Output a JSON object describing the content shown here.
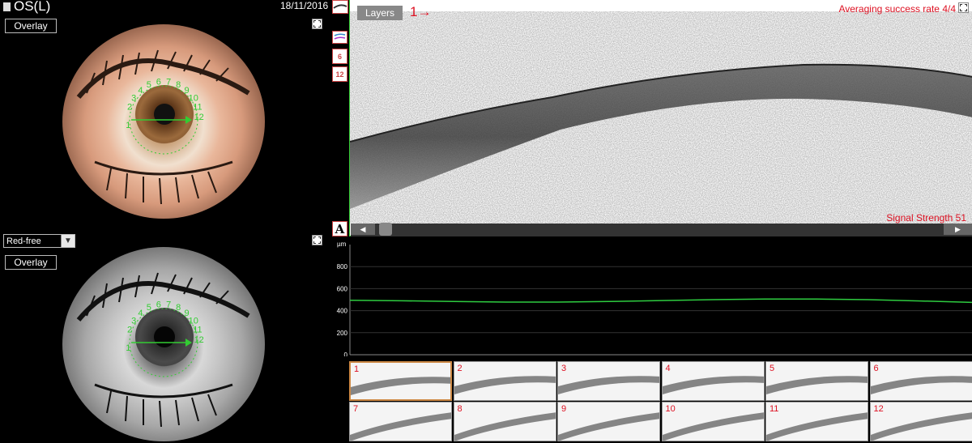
{
  "header": {
    "eye": "OS(L)",
    "date": "18/11/2016"
  },
  "left_panel": {
    "top_overlay_label": "Overlay",
    "filter_select_value": "Red-free",
    "bottom_overlay_label": "Overlay",
    "scan_overlay_numbers": [
      "1",
      "2",
      "3",
      "4",
      "5",
      "6",
      "7",
      "8",
      "9",
      "10",
      "11",
      "12"
    ]
  },
  "tools": {
    "tool_6_label": "6",
    "tool_12_label": "12",
    "a_label": "A"
  },
  "oct": {
    "layers_button": "Layers",
    "scan_indicator": "1→",
    "averaging": "Averaging success rate 4/4",
    "signal": "Signal Strength 51"
  },
  "chart_data": {
    "type": "line",
    "ylabel": "µm",
    "ylim": [
      0,
      1000
    ],
    "yticks": [
      0,
      200,
      400,
      600,
      800
    ],
    "series": [
      {
        "values": [
          495,
          490,
          484,
          478,
          478,
          483,
          492,
          500,
          505,
          505,
          500,
          488,
          475
        ]
      }
    ],
    "color": "#2ecc40"
  },
  "thumbnails": {
    "labels": [
      "1",
      "2",
      "3",
      "4",
      "5",
      "6",
      "7",
      "8",
      "9",
      "10",
      "11",
      "12"
    ],
    "selected": "1"
  },
  "colors": {
    "accent_red": "#dd1122",
    "border_green": "#33cc33"
  }
}
